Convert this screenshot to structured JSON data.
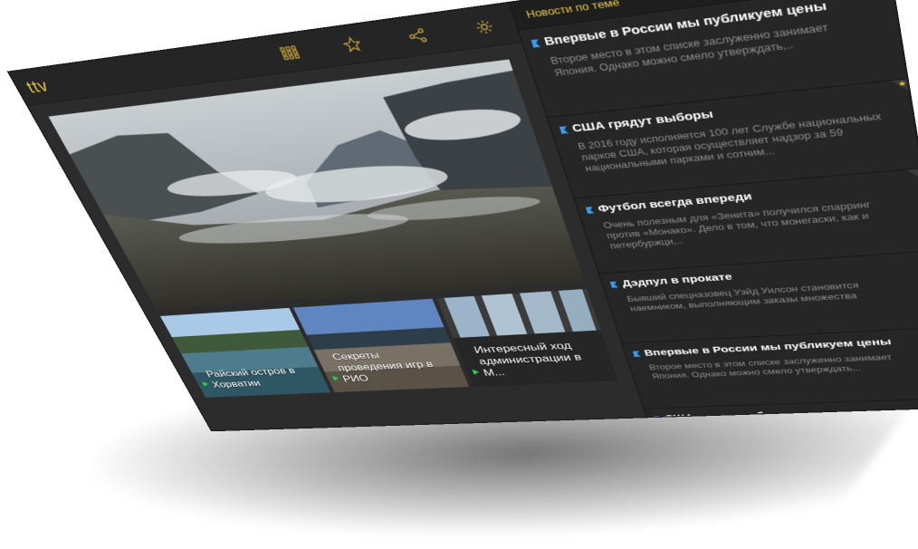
{
  "app": {
    "logo": "ttv"
  },
  "header": {
    "icons": [
      "grid-icon",
      "star-icon",
      "share-icon",
      "gear-icon"
    ]
  },
  "sidebar": {
    "title": "Новости по теме",
    "items": [
      {
        "title": "Впервые в России мы публикуем цены",
        "text": "Второе место в этом списке заслуженно занимает Япония. Однако можно смело утверждать,..",
        "starred": false
      },
      {
        "title": "США грядут выборы",
        "text": "В 2016 году исполняется 100 лет Службе национальных парков США, которая осуществляет надзор за 59 национальными парками и сотним...",
        "starred": true
      },
      {
        "title": "Футбол всегда впереди",
        "text": "Очень полезным для «Зенита» получился спарринг против «Монако». Дело в том, что монегаски, как и петербуржци,..",
        "starred": false
      },
      {
        "title": "Дэдпул в прокате",
        "text": "Бывший спецназовец Уэйд Уилсон становится наемником, выполняющим заказы множества",
        "starred": false
      },
      {
        "title": "Впервые в России мы публикуем цены",
        "text": "Второе место в этом списке заслуженно занимает Япония. Однако можно смело утверждать,..",
        "starred": true
      },
      {
        "title": "США грядут выборы",
        "text": "",
        "starred": true
      }
    ]
  },
  "tiles": [
    {
      "caption": "Райский остров в Хорватии"
    },
    {
      "caption": "Секреты проведения игр в РИО"
    },
    {
      "caption": "Интересный ход администрации в М..."
    }
  ],
  "colors": {
    "accent": "#e8c64a",
    "marker_green": "#2bd14d",
    "flag_blue": "#3a9bf0",
    "background": "#2c2c2c"
  }
}
